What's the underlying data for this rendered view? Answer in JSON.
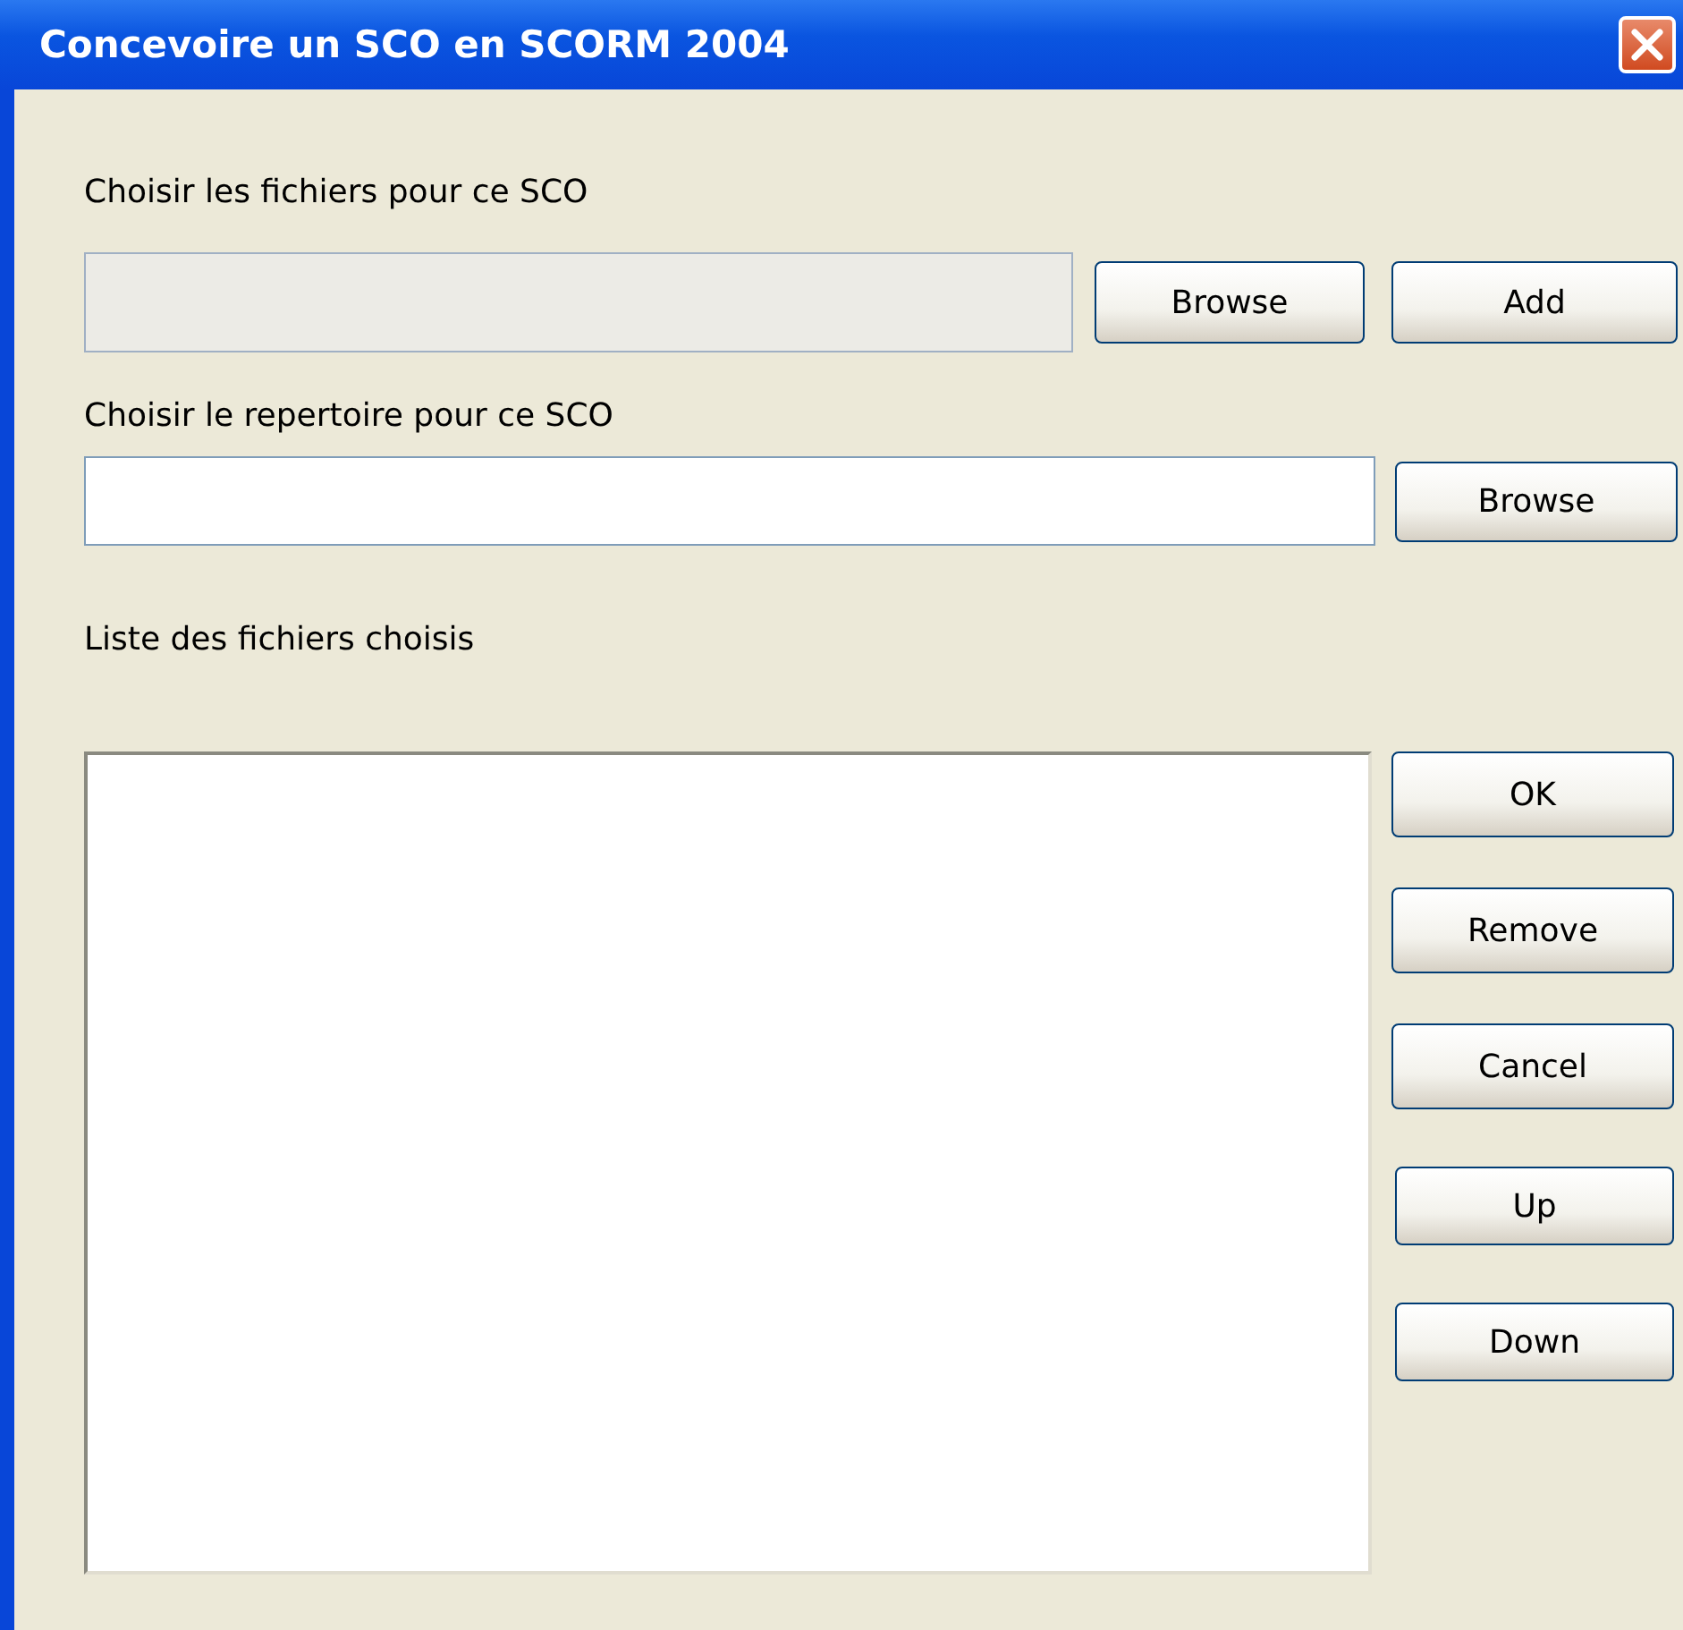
{
  "window": {
    "title": "Concevoire un SCO en SCORM 2004"
  },
  "files_section": {
    "label": "Choisir les fichiers pour ce SCO",
    "field": {
      "disabled": true
    },
    "buttons": [
      "Browse",
      "Add"
    ]
  },
  "directory_section": {
    "label": "Choisir le repertoire pour ce SCO",
    "field": {
      "disabled": false
    },
    "buttons": [
      "Browse"
    ]
  },
  "list_section": {
    "label": "Liste des fichiers choisis"
  },
  "side_buttons": [
    {
      "label": "OK",
      "kind": "wide"
    },
    {
      "label": "Remove",
      "kind": "wide"
    },
    {
      "label": "Cancel",
      "kind": "wide"
    },
    {
      "label": "Up",
      "kind": "narrow"
    },
    {
      "label": "Down",
      "kind": "narrow"
    }
  ]
}
